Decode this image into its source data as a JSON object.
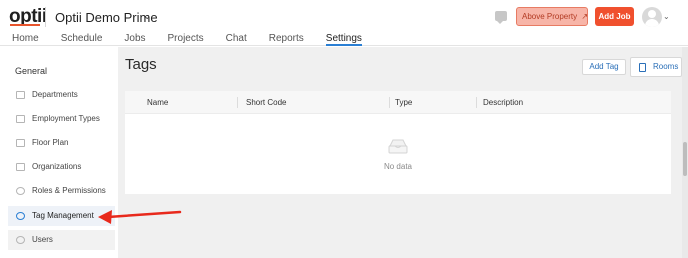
{
  "header": {
    "logo_text": "optii",
    "property_name": "Optii Demo Prime",
    "property_chevron": "⌄",
    "above_property_label": "Above Property",
    "above_property_icon": "↗",
    "add_job_label": "Add Job",
    "avatar_chevron": "⌄"
  },
  "nav": {
    "items": [
      "Home",
      "Schedule",
      "Jobs",
      "Projects",
      "Chat",
      "Reports",
      "Settings"
    ],
    "active": "Settings"
  },
  "sidebar": {
    "heading": "General",
    "items": [
      {
        "label": "Departments",
        "icon": "grid-icon"
      },
      {
        "label": "Employment Types",
        "icon": "id-card-icon"
      },
      {
        "label": "Floor Plan",
        "icon": "floor-plan-icon"
      },
      {
        "label": "Organizations",
        "icon": "organization-icon"
      },
      {
        "label": "Roles & Permissions",
        "icon": "key-icon"
      },
      {
        "label": "Tag Management",
        "icon": "tag-icon"
      },
      {
        "label": "Users",
        "icon": "users-icon"
      }
    ],
    "active": "Tag Management"
  },
  "main": {
    "title": "Tags",
    "add_tag_label": "Add Tag",
    "rooms_label": "Rooms",
    "table": {
      "columns": [
        "Name",
        "Short Code",
        "Type",
        "Description"
      ],
      "empty_text": "No data"
    }
  },
  "colors": {
    "accent_blue": "#2a7fd4",
    "add_job_red": "#f0502e",
    "above_property_bg": "#f7b5a8",
    "annotation_arrow": "#e8291c"
  }
}
